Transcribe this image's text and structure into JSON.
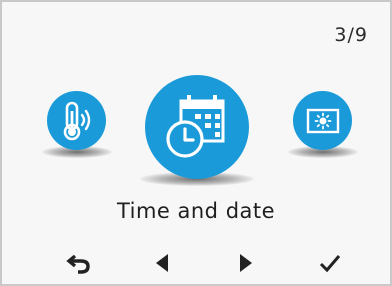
{
  "header": {
    "page_counter": "3/9"
  },
  "carousel": {
    "selected_label": "Time and date",
    "items": [
      {
        "icon": "thermometer-icon"
      },
      {
        "icon": "calendar-clock-icon"
      },
      {
        "icon": "display-brightness-icon"
      }
    ]
  },
  "navigation": {
    "buttons": [
      {
        "icon": "back-arrow-icon"
      },
      {
        "icon": "left-triangle-icon"
      },
      {
        "icon": "right-triangle-icon"
      },
      {
        "icon": "checkmark-icon"
      }
    ]
  },
  "colors": {
    "accent": "#1a9ad8",
    "text": "#1f1f1f",
    "background": "#f7f7f7"
  }
}
